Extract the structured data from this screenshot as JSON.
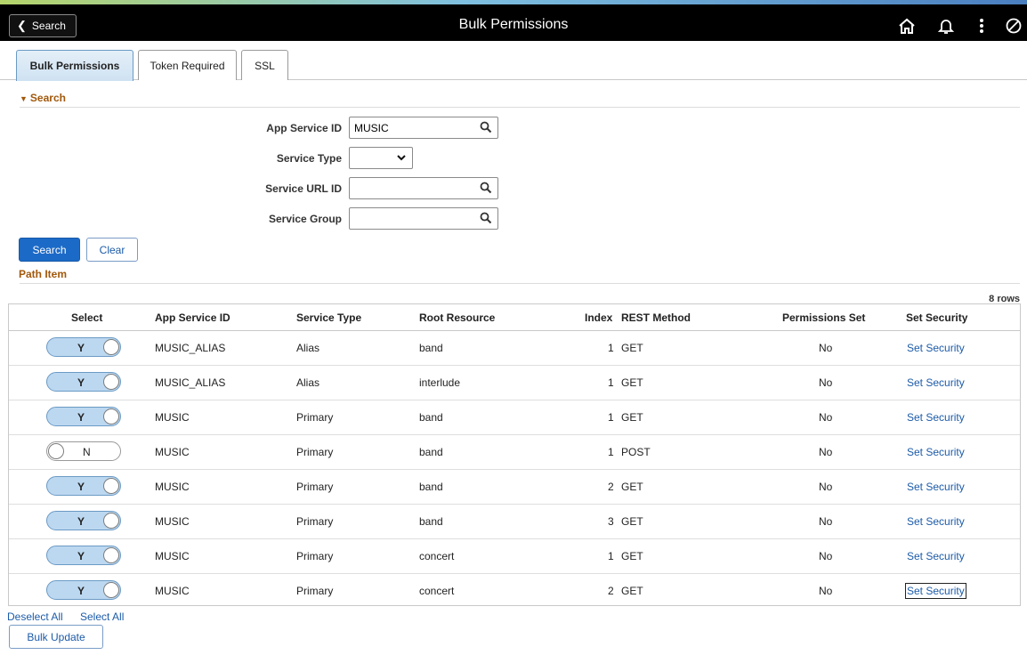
{
  "header": {
    "back_label": "Search",
    "title": "Bulk Permissions",
    "icons": [
      "home-icon",
      "bell-icon",
      "more-vertical-icon",
      "no-entry-icon"
    ]
  },
  "tabs": [
    {
      "label": "Bulk Permissions",
      "active": true
    },
    {
      "label": "Token Required",
      "active": false
    },
    {
      "label": "SSL",
      "active": false
    }
  ],
  "search_section": {
    "title": "Search",
    "fields": {
      "app_service_id": {
        "label": "App Service ID",
        "value": "MUSIC"
      },
      "service_type": {
        "label": "Service Type",
        "value": ""
      },
      "service_url_id": {
        "label": "Service URL ID",
        "value": ""
      },
      "service_group": {
        "label": "Service Group",
        "value": ""
      }
    },
    "search_button": "Search",
    "clear_button": "Clear"
  },
  "path_item": {
    "title": "Path Item",
    "row_count": "8 rows",
    "columns": [
      "Select",
      "App Service ID",
      "Service Type",
      "Root Resource",
      "Index",
      "REST Method",
      "Permissions Set",
      "Set Security"
    ],
    "rows": [
      {
        "select": "Y",
        "app_service_id": "MUSIC_ALIAS",
        "service_type": "Alias",
        "root_resource": "band",
        "index": "1",
        "rest_method": "GET",
        "permissions_set": "No",
        "set_security": "Set Security"
      },
      {
        "select": "Y",
        "app_service_id": "MUSIC_ALIAS",
        "service_type": "Alias",
        "root_resource": "interlude",
        "index": "1",
        "rest_method": "GET",
        "permissions_set": "No",
        "set_security": "Set Security"
      },
      {
        "select": "Y",
        "app_service_id": "MUSIC",
        "service_type": "Primary",
        "root_resource": "band",
        "index": "1",
        "rest_method": "GET",
        "permissions_set": "No",
        "set_security": "Set Security"
      },
      {
        "select": "N",
        "app_service_id": "MUSIC",
        "service_type": "Primary",
        "root_resource": "band",
        "index": "1",
        "rest_method": "POST",
        "permissions_set": "No",
        "set_security": "Set Security"
      },
      {
        "select": "Y",
        "app_service_id": "MUSIC",
        "service_type": "Primary",
        "root_resource": "band",
        "index": "2",
        "rest_method": "GET",
        "permissions_set": "No",
        "set_security": "Set Security"
      },
      {
        "select": "Y",
        "app_service_id": "MUSIC",
        "service_type": "Primary",
        "root_resource": "band",
        "index": "3",
        "rest_method": "GET",
        "permissions_set": "No",
        "set_security": "Set Security"
      },
      {
        "select": "Y",
        "app_service_id": "MUSIC",
        "service_type": "Primary",
        "root_resource": "concert",
        "index": "1",
        "rest_method": "GET",
        "permissions_set": "No",
        "set_security": "Set Security"
      },
      {
        "select": "Y",
        "app_service_id": "MUSIC",
        "service_type": "Primary",
        "root_resource": "concert",
        "index": "2",
        "rest_method": "GET",
        "permissions_set": "No",
        "set_security": "Set Security"
      }
    ]
  },
  "footer": {
    "deselect_all": "Deselect All",
    "select_all": "Select All",
    "bulk_update": "Bulk Update"
  }
}
